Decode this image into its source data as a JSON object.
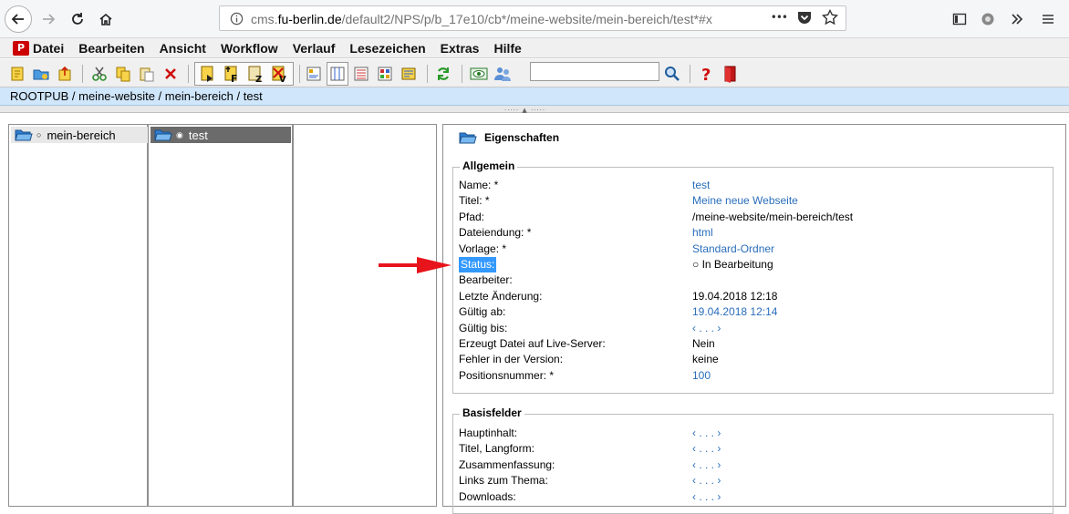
{
  "browser": {
    "url_prefix": "cms.",
    "url_host": "fu-berlin.de",
    "url_path": "/default2/NPS/p/b_17e10/cb*/meine-website/mein-bereich/test*#x",
    "more_glyph": "•••"
  },
  "menubar": {
    "logo_glyph": "P",
    "items": [
      "Datei",
      "Bearbeiten",
      "Ansicht",
      "Workflow",
      "Verlauf",
      "Lesezeichen",
      "Extras",
      "Hilfe"
    ]
  },
  "toolbar": {
    "search_value": "",
    "icons": [
      "new-file-icon",
      "new-folder-icon",
      "upload-icon",
      "cut-icon",
      "copy-icon",
      "paste-icon",
      "delete-icon",
      "page-icon",
      "page-f-icon",
      "page-z-icon",
      "page-v-icon",
      "view-1-icon",
      "view-2-icon",
      "view-3-icon",
      "view-4-icon",
      "view-5-icon",
      "refresh-icon",
      "preview-icon",
      "users-icon",
      "search-icon",
      "help-icon",
      "exit-icon"
    ]
  },
  "breadcrumb": {
    "path": "ROOTPUB / meine-website / mein-bereich / test"
  },
  "tree": {
    "col1_item": "mein-bereich",
    "col1_dot": "○",
    "col2_item": "test",
    "col2_dot": "◉"
  },
  "properties": {
    "header": "Eigenschaften",
    "allgemein_title": "Allgemein",
    "allgemein": [
      {
        "label": "Name: *",
        "value": "test",
        "link": true
      },
      {
        "label": "Titel: *",
        "value": "Meine neue Webseite",
        "link": true
      },
      {
        "label": "Pfad:",
        "value": "/meine-website/mein-bereich/test",
        "link": false
      },
      {
        "label": "Dateiendung: *",
        "value": "html",
        "link": true
      },
      {
        "label": "Vorlage: *",
        "value": "Standard-Ordner",
        "link": true
      },
      {
        "label": "Status:",
        "value": "○ In Bearbeitung",
        "link": false
      },
      {
        "label": "Bearbeiter:",
        "value": "",
        "link": false
      },
      {
        "label": "Letzte Änderung:",
        "value": "19.04.2018 12:18",
        "link": false
      },
      {
        "label": "Gültig ab:",
        "value": "19.04.2018 12:14",
        "link": true
      },
      {
        "label": "Gültig bis:",
        "value": "‹ . . . ›",
        "link": true
      },
      {
        "label": "Erzeugt Datei auf Live-Server:",
        "value": "Nein",
        "link": false
      },
      {
        "label": "Fehler in der Version:",
        "value": "keine",
        "link": false
      },
      {
        "label": "Positionsnummer: *",
        "value": "100",
        "link": true
      }
    ],
    "basis_title": "Basisfelder",
    "basis": [
      {
        "label": "Hauptinhalt:",
        "value": "‹ . . . ›",
        "link": true
      },
      {
        "label": "Titel, Langform:",
        "value": "‹ . . . ›",
        "link": true
      },
      {
        "label": "Zusammenfassung:",
        "value": "‹ . . . ›",
        "link": true
      },
      {
        "label": "Links zum Thema:",
        "value": "‹ . . . ›",
        "link": true
      },
      {
        "label": "Downloads:",
        "value": "‹ . . . ›",
        "link": true
      }
    ]
  },
  "colors": {
    "link": "#2a6ebb",
    "arrow": "#e8141c",
    "selection": "#3399ff",
    "breadcrumb_bg": "#cfe6fb"
  }
}
